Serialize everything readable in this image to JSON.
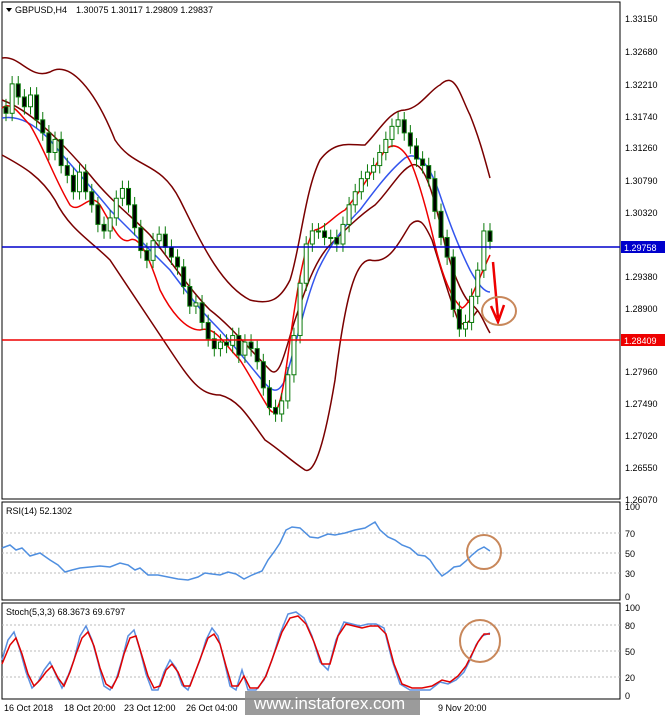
{
  "header": {
    "symbol": "GBPUSD,H4",
    "ohlc": "1.30075 1.30117 1.29809 1.29837"
  },
  "price_axis": {
    "labels": [
      "1.33150",
      "1.32680",
      "1.32210",
      "1.31740",
      "1.31260",
      "1.30790",
      "1.30320",
      "1.29380",
      "1.28900",
      "1.27960",
      "1.27490",
      "1.27020",
      "1.26550",
      "1.26070"
    ]
  },
  "levels": {
    "blue": {
      "label": "1.29758",
      "value": 1.29758,
      "color": "#0000cc"
    },
    "red": {
      "label": "1.28409",
      "value": 1.28409,
      "color": "#ee0000"
    }
  },
  "rsi": {
    "title": "RSI(14) 52.1302",
    "axis_labels": [
      "100",
      "70",
      "50",
      "30",
      "0"
    ]
  },
  "stoch": {
    "title": "Stoch(5,3,3) 68.3673 69.6797",
    "axis_labels": [
      "100",
      "80",
      "50",
      "20",
      "0"
    ]
  },
  "time_axis": {
    "labels": [
      "16 Oct 2018",
      "18 Oct 20:00",
      "23 Oct 12:00",
      "26 Oct 04:00",
      "",
      "",
      "",
      "",
      "9 Nov 20:00"
    ]
  },
  "watermark": "www.instaforex.com",
  "colors": {
    "candle": "#0a7a0a",
    "bollinger": "#7a0000",
    "ma_fast": "#ee0000",
    "ma_slow": "#3355ee",
    "rsi_line": "#4f8fe0",
    "stoch_main": "#5b8fe0",
    "stoch_signal": "#e00000",
    "highlight_circle": "#c8875a",
    "arrow": "#ee0000"
  },
  "chart_data": {
    "type": "candlestick",
    "symbol": "GBPUSD",
    "timeframe": "H4",
    "ylim": [
      1.2593,
      1.3338
    ],
    "close": [
      1.318,
      1.3225,
      1.3205,
      1.319,
      1.3208,
      1.317,
      1.315,
      1.312,
      1.314,
      1.31,
      1.3085,
      1.306,
      1.309,
      1.306,
      1.304,
      1.301,
      1.3,
      1.302,
      1.305,
      1.3065,
      1.304,
      1.3005,
      1.297,
      1.2955,
      1.2985,
      1.2995,
      1.2975,
      1.296,
      1.2945,
      1.2915,
      1.2885,
      1.289,
      1.286,
      1.2835,
      1.282,
      1.283,
      1.2825,
      1.284,
      1.281,
      1.283,
      1.282,
      1.28,
      1.276,
      1.273,
      1.272,
      1.274,
      1.278,
      1.284,
      1.292,
      1.298,
      1.3,
      1.3,
      1.299,
      1.299,
      1.298,
      1.301,
      1.304,
      1.306,
      1.308,
      1.309,
      1.31,
      1.312,
      1.314,
      1.316,
      1.317,
      1.315,
      1.313,
      1.311,
      1.31,
      1.308,
      1.303,
      1.299,
      1.296,
      1.288,
      1.285,
      1.286,
      1.29,
      1.294,
      1.3,
      1.2984
    ],
    "bollinger_upper": [
      1.3262,
      1.3258,
      1.324,
      1.322,
      1.32,
      1.318,
      1.315,
      1.31,
      1.3085,
      1.308,
      1.307,
      1.306,
      1.303,
      1.298,
      1.295,
      1.292,
      1.29,
      1.287,
      1.286,
      1.2855,
      1.288,
      1.298,
      1.308,
      1.312,
      1.314,
      1.315,
      1.316,
      1.317,
      1.3165,
      1.3155,
      1.315,
      1.317,
      1.32,
      1.322,
      1.323,
      1.3232,
      1.322,
      1.32,
      1.318,
      1.314,
      1.308
    ],
    "bollinger_lower": [
      1.31,
      1.308,
      1.305,
      1.303,
      1.3,
      1.295,
      1.29,
      1.286,
      1.284,
      1.282,
      1.28,
      1.279,
      1.278,
      1.276,
      1.273,
      1.27,
      1.269,
      1.267,
      1.264,
      1.26,
      1.261,
      1.27,
      1.283,
      1.29,
      1.2935,
      1.295,
      1.2945,
      1.295,
      1.298,
      1.301,
      1.302,
      1.3,
      1.297,
      1.293,
      1.288,
      1.284,
      1.281,
      1.28,
      1.2815,
      1.283,
      1.284
    ],
    "support_resistance": [
      1.29758,
      1.28409
    ],
    "forecast_target": 1.28409,
    "rsi": {
      "value": 52.1302,
      "ylim": [
        0,
        100
      ],
      "levels": [
        70,
        50,
        30
      ]
    },
    "stochastic": {
      "main": 68.3673,
      "signal": 69.6797,
      "ylim": [
        0,
        100
      ],
      "levels": [
        80,
        50,
        20
      ]
    }
  }
}
